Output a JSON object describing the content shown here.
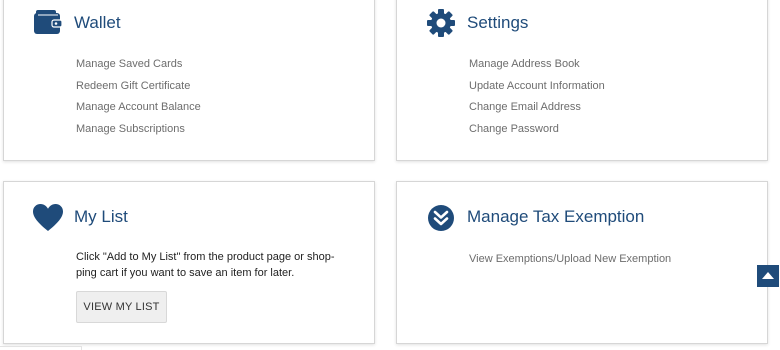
{
  "colors": {
    "accent": "#1f4b7a",
    "link": "#6d6d6d"
  },
  "wallet": {
    "title": "Wallet",
    "icon": "wallet-icon",
    "links": [
      "Manage Saved Cards",
      "Redeem Gift Certificate",
      "Manage Account Balance",
      "Manage Subscriptions"
    ]
  },
  "settings": {
    "title": "Settings",
    "icon": "gear-icon",
    "links": [
      "Manage Address Book",
      "Update Account Information",
      "Change Email Address",
      "Change Password"
    ]
  },
  "mylist": {
    "title": "My List",
    "icon": "heart-icon",
    "description": "Click \"Add to My List\" from the product page or shop-ping cart if you want to save an item for later.",
    "button_label": "VIEW MY LIST"
  },
  "tax": {
    "title": "Manage Tax Exemption",
    "icon": "double-chevron-down-icon",
    "links": [
      "View Exemptions/Upload New Exemption"
    ]
  },
  "scroll_top": {
    "icon": "arrow-up-icon"
  }
}
